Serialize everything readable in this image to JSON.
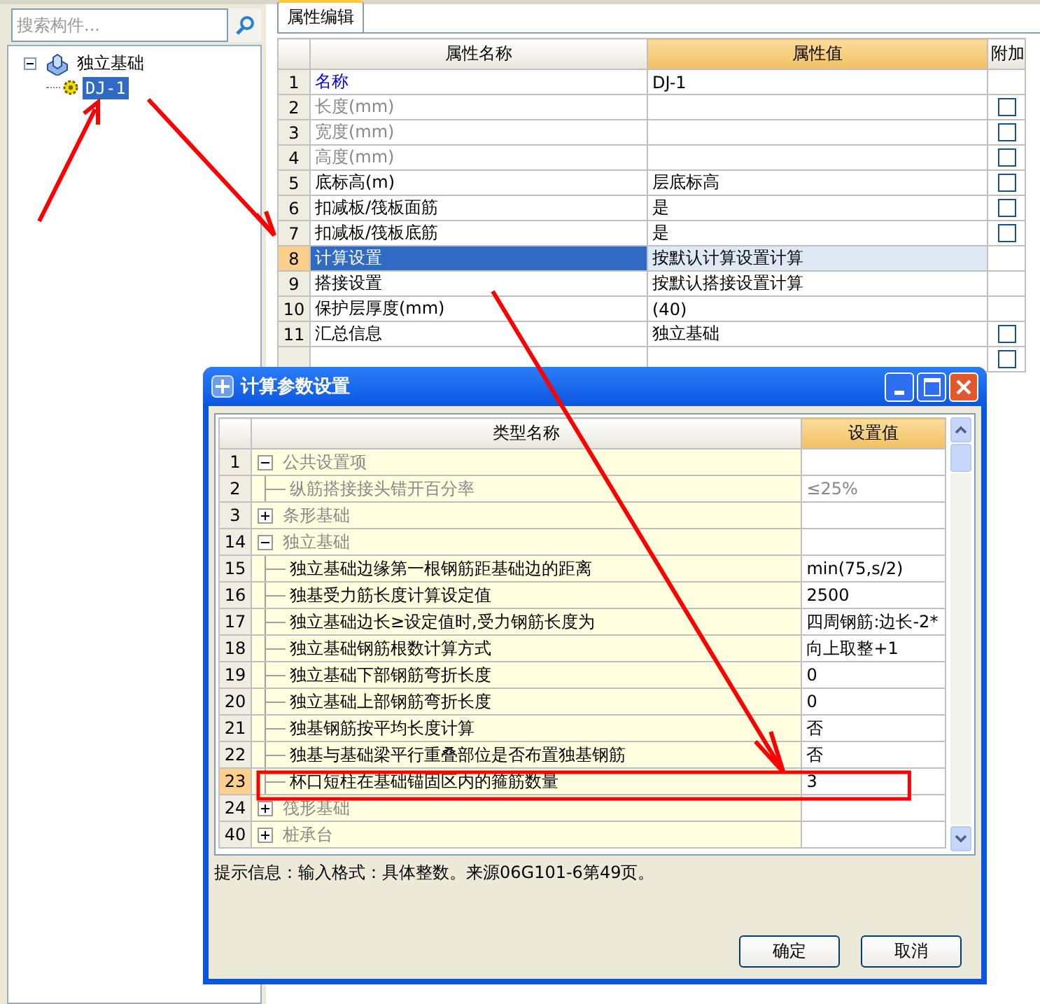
{
  "left_panel": {
    "search": {
      "placeholder": "搜索构件..."
    },
    "tree": [
      {
        "label": "独立基础",
        "expanded": true,
        "selected": false,
        "children": [
          {
            "label": "DJ-1",
            "selected": true
          }
        ]
      }
    ]
  },
  "tabs": [
    {
      "label": "属性编辑",
      "selected": true
    }
  ],
  "property_grid": {
    "columns": [
      "属性名称",
      "属性值",
      "附加"
    ],
    "rows": [
      {
        "num": "1",
        "name": "名称",
        "value": "DJ-1",
        "kind": "primary",
        "disabled": false,
        "selected": false
      },
      {
        "num": "2",
        "name": "长度(mm)",
        "kind": "normal",
        "disabled": true,
        "selected": false,
        "checked": false
      },
      {
        "num": "3",
        "name": "宽度(mm)",
        "kind": "normal",
        "disabled": true,
        "selected": false,
        "checked": false
      },
      {
        "num": "4",
        "name": "高度(mm)",
        "kind": "normal",
        "disabled": true,
        "selected": false,
        "checked": false
      },
      {
        "num": "5",
        "name": "底标高(m)",
        "value": "层底标高",
        "kind": "normal",
        "disabled": false,
        "selected": false,
        "checked": false
      },
      {
        "num": "6",
        "name": "扣减板/筏板面筋",
        "value": "是",
        "kind": "normal",
        "disabled": false,
        "selected": false,
        "checked": false
      },
      {
        "num": "7",
        "name": "扣减板/筏板底筋",
        "value": "是",
        "kind": "normal",
        "disabled": false,
        "selected": false,
        "checked": false
      },
      {
        "num": "8",
        "name": "计算设置",
        "value": "按默认计算设置计算",
        "kind": "normal",
        "disabled": false,
        "selected": true
      },
      {
        "num": "9",
        "name": "搭接设置",
        "value": "按默认搭接设置计算",
        "kind": "normal",
        "disabled": false,
        "selected": false
      },
      {
        "num": "10",
        "name": "保护层厚度(mm)",
        "value": "(40)",
        "kind": "normal",
        "disabled": false,
        "selected": false
      },
      {
        "num": "11",
        "name": "汇总信息",
        "value": "独立基础",
        "kind": "normal",
        "disabled": false,
        "selected": false,
        "checked": false
      },
      {
        "kind": "normal",
        "checked": false
      }
    ]
  },
  "dialog": {
    "title": "计算参数设置",
    "columns": [
      "类型名称",
      "设置值"
    ],
    "rows": [
      {
        "num": "1",
        "name": "公共设置项",
        "expanded": true,
        "selected": false,
        "children": [
          {
            "num": "2",
            "name": "纵筋搭接接头错开百分率",
            "value": "≤25%",
            "disabled": true,
            "selected": false
          }
        ]
      },
      {
        "num": "3",
        "name": "条形基础",
        "expanded": false,
        "selected": false
      },
      {
        "num": "14",
        "name": "独立基础",
        "expanded": true,
        "selected": false,
        "children": [
          {
            "num": "15",
            "name": "独立基础边缘第一根钢筋距基础边的距离",
            "value": "min(75,s/2)",
            "disabled": false,
            "selected": false
          },
          {
            "num": "16",
            "name": "独基受力筋长度计算设定值",
            "value": "2500",
            "disabled": false,
            "selected": false
          },
          {
            "num": "17",
            "name": "独立基础边长≥设定值时,受力钢筋长度为",
            "value": "四周钢筋:边长-2*",
            "disabled": false,
            "selected": false
          },
          {
            "num": "18",
            "name": "独立基础钢筋根数计算方式",
            "value": "向上取整+1",
            "disabled": false,
            "selected": false
          },
          {
            "num": "19",
            "name": "独立基础下部钢筋弯折长度",
            "value": "0",
            "disabled": false,
            "selected": false
          },
          {
            "num": "20",
            "name": "独立基础上部钢筋弯折长度",
            "value": "0",
            "disabled": false,
            "selected": false
          },
          {
            "num": "21",
            "name": "独基钢筋按平均长度计算",
            "value": "否",
            "disabled": false,
            "selected": false
          },
          {
            "num": "22",
            "name": "独基与基础梁平行重叠部位是否布置独基钢筋",
            "value": "否",
            "disabled": false,
            "selected": false
          },
          {
            "num": "23",
            "name": "杯口短柱在基础锚固区内的箍筋数量",
            "value": "3",
            "disabled": false,
            "selected": true
          }
        ]
      },
      {
        "num": "24",
        "name": "筏形基础",
        "expanded": false,
        "selected": false
      },
      {
        "num": "40",
        "name": "桩承台",
        "expanded": false,
        "selected": false
      }
    ],
    "hint": "提示信息：输入格式：具体整数。来源06G101-6第49页。",
    "buttons": [
      "确定",
      "取消"
    ]
  }
}
